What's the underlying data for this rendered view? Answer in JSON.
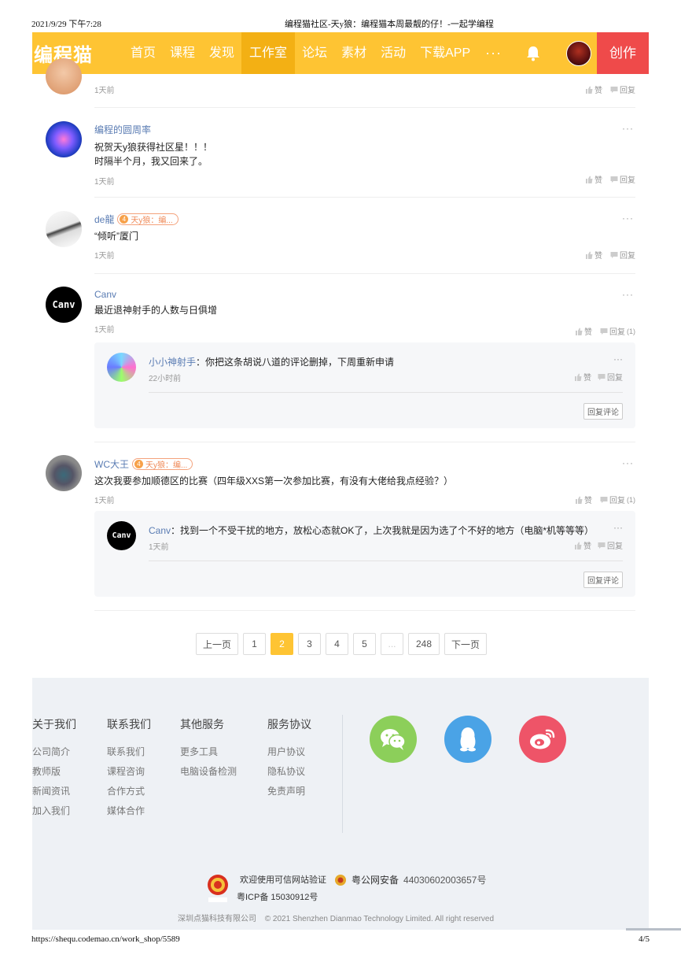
{
  "print": {
    "date": "2021/9/29 下午7:28",
    "title": "编程猫社区-天y狼：编程猫本周最靓的仔！-一起学编程",
    "url": "https://shequ.codemao.cn/work_shop/5589",
    "page": "4/5"
  },
  "navbar": {
    "logo": "编程猫",
    "items": [
      "首页",
      "课程",
      "发现",
      "工作室",
      "论坛",
      "素材",
      "活动",
      "下载APP"
    ],
    "active": "工作室",
    "more": "···",
    "create_label": "创作",
    "colors": {
      "bar": "#fec433",
      "active": "#f3b014",
      "create": "#ef4a4a"
    }
  },
  "comments": [
    {
      "name": "",
      "text": "",
      "time": "1天前",
      "like": "赞",
      "reply": "回复"
    },
    {
      "name": "编程的圆周率",
      "text_lines": [
        "祝贺天y狼获得社区星！！！",
        "时隔半个月，我又回来了。"
      ],
      "time": "1天前",
      "like": "赞",
      "reply": "回复",
      "more": "···"
    },
    {
      "name": "de龍",
      "badge_level": "4",
      "badge_text": "天y狼：编...",
      "text": "“倾听”厦门",
      "time": "1天前",
      "like": "赞",
      "reply": "回复",
      "more": "···"
    },
    {
      "name": "Canv",
      "text": "最近退神射手的人数与日俱增",
      "time": "1天前",
      "like": "赞",
      "reply": "回复",
      "reply_count": "(1)",
      "more": "···",
      "avatar_text": "Canv",
      "sub_reply": {
        "name": "小小神射手",
        "text": "：你把这条胡说八道的评论删掉，下周重新申请",
        "time": "22小时前",
        "like": "赞",
        "reply": "回复",
        "more": "···",
        "btn": "回复评论"
      }
    },
    {
      "name": "WC大王",
      "badge_level": "4",
      "badge_text": "天y狼：编...",
      "text": "这次我要参加顺德区的比赛（四年级XXS第一次参加比赛，有没有大佬给我点经验？）",
      "time": "1天前",
      "like": "赞",
      "reply": "回复",
      "reply_count": "(1)",
      "more": "···",
      "sub_reply": {
        "name": "Canv",
        "text": "：找到一个不受干扰的地方，放松心态就OK了，上次我就是因为选了个不好的地方（电脑*机等等等）",
        "time": "1天前",
        "like": "赞",
        "reply": "回复",
        "more": "···",
        "btn": "回复评论",
        "avatar_text": "Canv"
      }
    }
  ],
  "pagination": {
    "prev": "上一页",
    "pages": [
      "1",
      "2",
      "3",
      "4",
      "5",
      "...",
      "248"
    ],
    "current": "2",
    "next": "下一页"
  },
  "footer": {
    "columns": [
      {
        "head": "关于我们",
        "links": [
          "公司简介",
          "教师版",
          "新闻资讯",
          "加入我们"
        ]
      },
      {
        "head": "联系我们",
        "links": [
          "联系我们",
          "课程咨询",
          "合作方式",
          "媒体合作"
        ]
      },
      {
        "head": "其他服务",
        "links": [
          "更多工具",
          "电脑设备检测"
        ]
      },
      {
        "head": "服务协议",
        "links": [
          "用户协议",
          "隐私协议",
          "免责声明"
        ]
      }
    ],
    "social_colors": {
      "wechat": "#8ccf5a",
      "qq": "#4aa3e6",
      "weibo": "#ee5468"
    },
    "verify": "欢迎使用可信网站验证",
    "police_label": "粤公网安备",
    "police_num": "44030602003657号",
    "icp": "粤ICP备 15030912号",
    "company": "深圳点猫科技有限公司",
    "copyright": "© 2021 Shenzhen Dianmao Technology Limited. All right reserved"
  }
}
